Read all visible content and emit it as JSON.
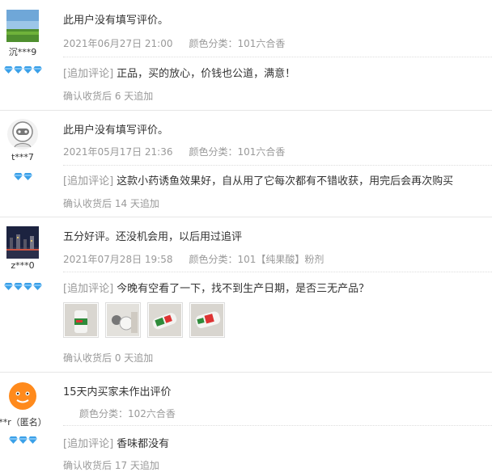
{
  "reviews": [
    {
      "username": "沉***9",
      "content": "此用户没有填写评价。",
      "date": "2021年06月27日 21:00",
      "color_label": "颜色分类：",
      "color_value": "101六合香",
      "append_tag": "[追加评论]",
      "append_text": "正品，买的放心，价钱也公道，满意！",
      "confirm": "确认收货后 6 天追加",
      "diamonds": 4
    },
    {
      "username": "t***7",
      "content": "此用户没有填写评价。",
      "date": "2021年05月17日 21:36",
      "color_label": "颜色分类：",
      "color_value": "101六合香",
      "append_tag": "[追加评论]",
      "append_text": "这款小药诱鱼效果好，自从用了它每次都有不错收获，用完后会再次购买",
      "confirm": "确认收货后 14 天追加",
      "diamonds": 2
    },
    {
      "username": "z***0",
      "content": "五分好评。还没机会用，以后用过追评",
      "date": "2021年07月28日 19:58",
      "color_label": "颜色分类：",
      "color_value": "101【纯果酸】粉剂",
      "append_tag": "[追加评论]",
      "append_text": "今晚有空看了一下，找不到生产日期，是否三无产品？",
      "confirm": "确认收货后 0 天追加",
      "diamonds": 4,
      "photo_count": 4
    },
    {
      "username": "**r（匿名）",
      "content": "15天内买家未作出评价",
      "date": "",
      "color_label": "颜色分类：",
      "color_value": "102六合香",
      "append_tag": "[追加评论]",
      "append_text": "香味都没有",
      "confirm": "确认收货后 17 天追加",
      "diamonds": 3
    }
  ],
  "colors": {
    "meta": "#999999",
    "text": "#333333",
    "diamond": "#3aa0e8",
    "divider": "#e6e6e6"
  }
}
